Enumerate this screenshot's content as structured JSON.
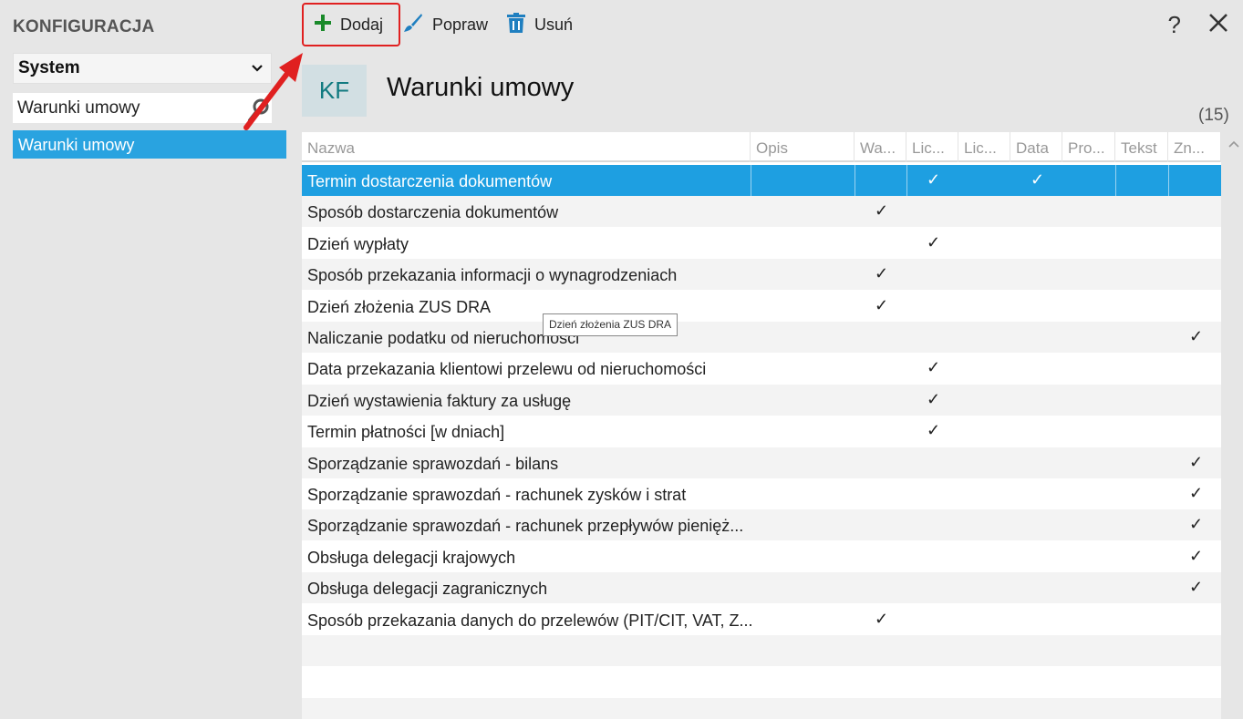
{
  "sidebar": {
    "title": "KONFIGURACJA",
    "select_value": "System",
    "search_value": "Warunki umowy",
    "items": [
      {
        "label": "Warunki umowy"
      }
    ]
  },
  "toolbar": {
    "add_label": "Dodaj",
    "edit_label": "Popraw",
    "delete_label": "Usuń",
    "help_label": "?"
  },
  "header": {
    "badge": "KF",
    "title": "Warunki umowy",
    "count": "(15)"
  },
  "columns": [
    "Nazwa",
    "Opis",
    "Wa...",
    "Lic...",
    "Lic...",
    "Data",
    "Pro...",
    "Tekst",
    "Zn..."
  ],
  "check_glyph": "✓",
  "rows": [
    {
      "name": "Termin dostarczenia dokumentów",
      "checks": [
        3,
        5
      ]
    },
    {
      "name": "Sposób dostarczenia dokumentów",
      "checks": [
        2
      ]
    },
    {
      "name": "Dzień wypłaty",
      "checks": [
        3
      ]
    },
    {
      "name": "Sposób przekazania informacji o wynagrodzeniach",
      "checks": [
        2
      ]
    },
    {
      "name": "Dzień złożenia ZUS DRA",
      "checks": [
        2
      ]
    },
    {
      "name": "Naliczanie podatku od nieruchomości",
      "checks": [
        8
      ]
    },
    {
      "name": "Data przekazania klientowi przelewu od nieruchomości",
      "checks": [
        3
      ]
    },
    {
      "name": "Dzień wystawienia faktury za usługę",
      "checks": [
        3
      ]
    },
    {
      "name": "Termin płatności [w dniach]",
      "checks": [
        3
      ]
    },
    {
      "name": "Sporządzanie sprawozdań - bilans",
      "checks": [
        8
      ]
    },
    {
      "name": "Sporządzanie sprawozdań - rachunek zysków i strat",
      "checks": [
        8
      ]
    },
    {
      "name": "Sporządzanie sprawozdań - rachunek przepływów pienięż...",
      "checks": [
        8
      ]
    },
    {
      "name": "Obsługa delegacji krajowych",
      "checks": [
        8
      ]
    },
    {
      "name": "Obsługa delegacji zagranicznych",
      "checks": [
        8
      ]
    },
    {
      "name": "Sposób przekazania danych do przelewów (PIT/CIT, VAT, Z...",
      "checks": [
        2
      ]
    }
  ],
  "selected_row": 0,
  "tooltip": "Dzień złożenia ZUS DRA",
  "colors": {
    "accent": "#1e9fe1",
    "add_icon": "#1a8a2a",
    "icon_blue": "#1f7fc0",
    "highlight": "#e02020"
  }
}
